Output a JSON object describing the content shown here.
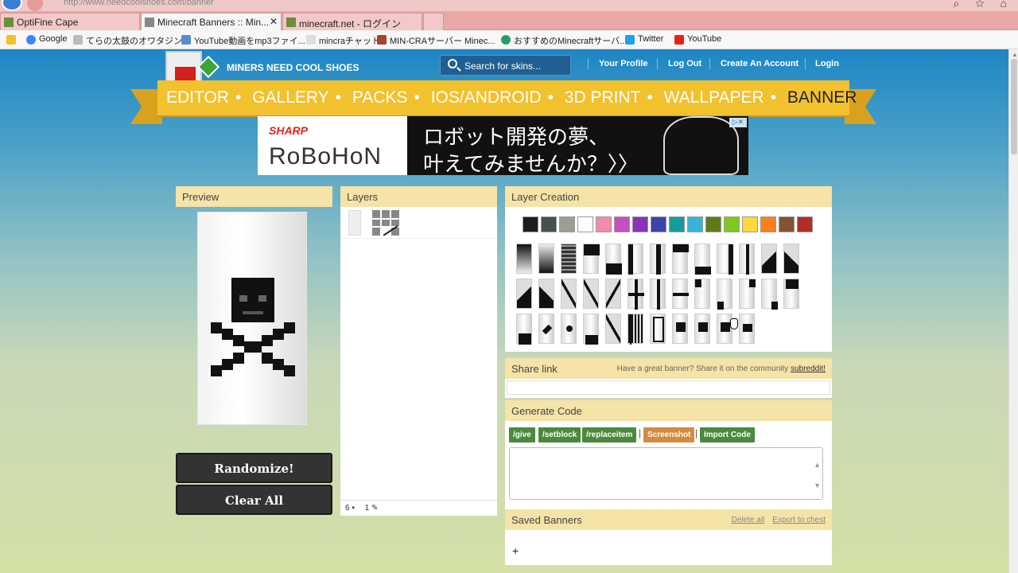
{
  "browser": {
    "url": "http://www.needcoolshoes.com/banner",
    "tabs": [
      {
        "label": "OptiFine Cape"
      },
      {
        "label": "Minecraft Banners :: Min..."
      },
      {
        "label": "minecraft.net - ログイン"
      }
    ],
    "bookmarks": [
      {
        "label": "Google"
      },
      {
        "label": "てらの太鼓のオワタジン"
      },
      {
        "label": "YouTube動画をmp3ファイ..."
      },
      {
        "label": "mincraチャット"
      },
      {
        "label": "MIN-CRAサーバー Minec..."
      },
      {
        "label": "おすすめのMinecraftサーバ..."
      },
      {
        "label": "Twitter"
      },
      {
        "label": "YouTube"
      }
    ]
  },
  "site": {
    "name": "MINERS NEED COOL SHOES",
    "search_placeholder": "Search for skins...",
    "nav_links": [
      "Your Profile",
      "Log Out",
      "Create An Account",
      "Login"
    ],
    "menu": [
      "EDITOR",
      "GALLERY",
      "PACKS",
      "IOS/ANDROID",
      "3D PRINT",
      "WALLPAPER",
      "BANNER"
    ],
    "menu_active": "BANNER",
    "menu_separator": "•"
  },
  "ad": {
    "brand": "SHARP",
    "product": "RoBoHoN",
    "line1": "ロボット開発の夢、",
    "line2": "叶えてみませんか？〉〉"
  },
  "preview": {
    "title": "Preview",
    "randomize_label": "Randomize!",
    "clear_label": "Clear All"
  },
  "layers": {
    "title": "Layers",
    "footer_count": "6",
    "footer_edit": "1"
  },
  "layer_creation": {
    "title": "Layer Creation",
    "colors": [
      "#1d1d21",
      "#474f52",
      "#9d9d97",
      "#f9fffe",
      "#f38baa",
      "#c74ebd",
      "#8932b8",
      "#3c44aa",
      "#169c9c",
      "#3ab3da",
      "#5e7c16",
      "#80c71f",
      "#fed83d",
      "#f9801d",
      "#835432",
      "#b02e26"
    ]
  },
  "share_link": {
    "title": "Share link",
    "hint": "Have a great banner? Share it on the community",
    "hint_link": "subreddit!"
  },
  "generate_code": {
    "title": "Generate Code",
    "buttons": [
      "/give",
      "/setblock",
      "/replaceitem",
      "Screenshot",
      "Import Code"
    ]
  },
  "saved_banners": {
    "title": "Saved Banners",
    "delete_all": "Delete all",
    "export": "Export to chest",
    "add": "+"
  }
}
